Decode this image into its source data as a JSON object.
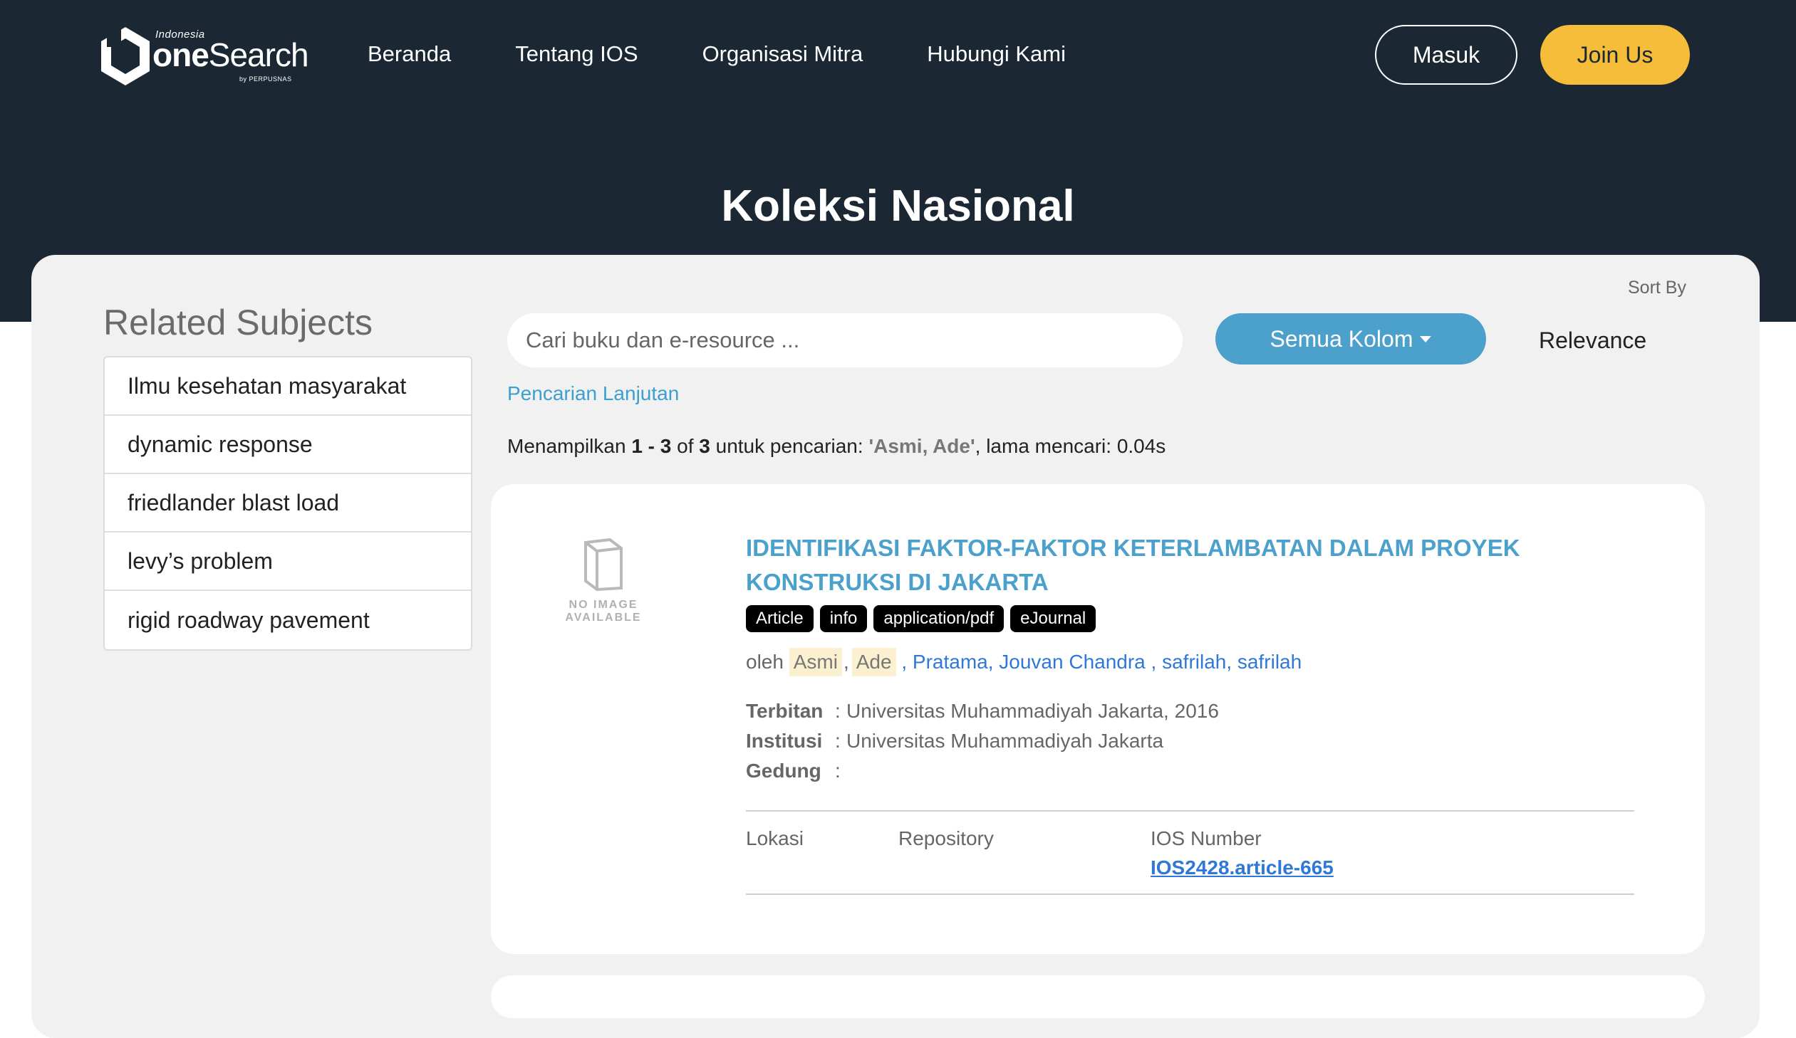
{
  "header": {
    "logo": {
      "top_text": "Indonesia",
      "brand_light": "one",
      "brand_rest": "Search",
      "bottom_text": "by PERPUSNAS"
    },
    "nav": [
      "Beranda",
      "Tentang IOS",
      "Organisasi Mitra",
      "Hubungi Kami"
    ],
    "masuk_label": "Masuk",
    "join_label": "Join Us",
    "page_title": "Koleksi Nasional"
  },
  "sidebar": {
    "title": "Related Subjects",
    "items": [
      "Ilmu kesehatan masyarakat",
      "dynamic response",
      "friedlander blast load",
      "levy’s problem",
      "rigid roadway pavement"
    ]
  },
  "search": {
    "placeholder": "Cari buku dan e-resource ...",
    "column_button": "Semua Kolom",
    "sort_label": "Sort By",
    "sort_value": "Relevance",
    "advanced_link": "Pencarian Lanjutan"
  },
  "summary": {
    "prefix": "Menampilkan ",
    "range": "1 - 3",
    "of_text": " of ",
    "total": "3",
    "query_text": " untuk pencarian: ",
    "query": "'Asmi, Ade'",
    "time_text": ", lama mencari: 0.04s"
  },
  "result": {
    "no_image_line1": "NO IMAGE",
    "no_image_line2": "AVAILABLE",
    "title": "IDENTIFIKASI FAKTOR-FAKTOR KETERLAMBATAN DALAM PROYEK KONSTRUKSI DI JAKARTA",
    "badges": [
      "Article",
      "info",
      "application/pdf",
      "eJournal"
    ],
    "by": "oleh",
    "author_hl1": "Asmi",
    "author_hl2": "Ade",
    "author_sep": ",",
    "author_link1": ", Pratama, Jouvan Chandra",
    "author_link2": ", safrilah, safrilah",
    "terbitan_label": "Terbitan",
    "terbitan_value": "Universitas Muhammadiyah Jakarta, 2016",
    "institusi_label": "Institusi",
    "institusi_value": "Universitas Muhammadiyah Jakarta",
    "gedung_label": "Gedung",
    "gedung_value": "",
    "colon": ":",
    "lokasi_label": "Lokasi",
    "repository_label": "Repository",
    "ios_label": "IOS Number",
    "ios_value": "IOS2428.article-665"
  },
  "colors": {
    "header_bg": "#1b2733",
    "join_bg": "#f6bd3a",
    "accent_blue": "#4ca0cc",
    "link_blue": "#2f78d8"
  }
}
